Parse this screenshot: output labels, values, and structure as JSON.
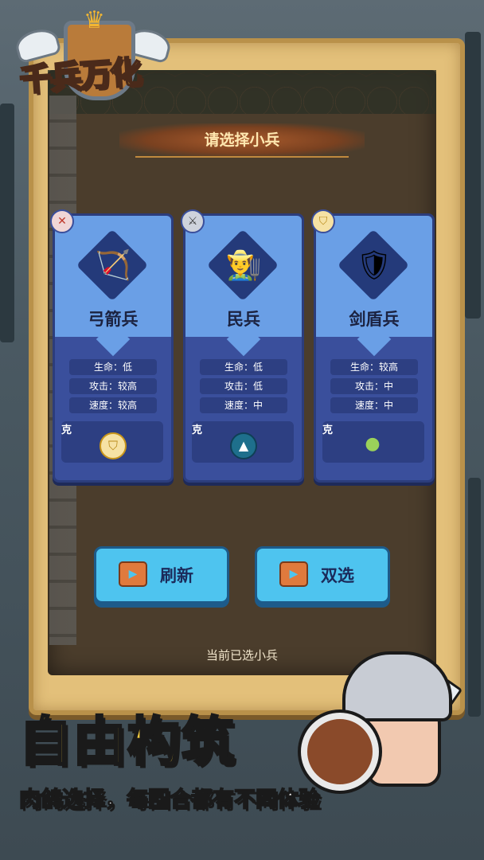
{
  "logo": {
    "title": "千兵万化"
  },
  "header": {
    "title": "请选择小兵"
  },
  "cards": [
    {
      "name": "弓箭兵",
      "class_icon": "crossed-bow-icon",
      "unit_icon": "archer-icon",
      "stats": [
        "生命：低",
        "攻击：较高",
        "速度：较高"
      ],
      "counter_label": "克",
      "counter_icon": "shield-icon"
    },
    {
      "name": "民兵",
      "class_icon": "sword-icon",
      "unit_icon": "militia-icon",
      "stats": [
        "生命：低",
        "攻击：低",
        "速度：中"
      ],
      "counter_label": "克",
      "counter_icon": "mountain-icon"
    },
    {
      "name": "剑盾兵",
      "class_icon": "shield-icon",
      "unit_icon": "swordsman-icon",
      "stats": [
        "生命：较高",
        "攻击：中",
        "速度：中"
      ],
      "counter_label": "克",
      "counter_icon": "slime-icon"
    }
  ],
  "buttons": {
    "refresh_label": "刷新",
    "double_label": "双选",
    "icon": "video-ad-icon"
  },
  "current_selected_label": "当前已选小兵",
  "slogan": "自由构筑",
  "sub_slogan": "肉鸽选择，每回合都有不同体验",
  "colors": {
    "card_top": "#6a9fe6",
    "card_body": "#3a4f9c",
    "button": "#4ec4ef",
    "slogan": "#ffd23f"
  }
}
